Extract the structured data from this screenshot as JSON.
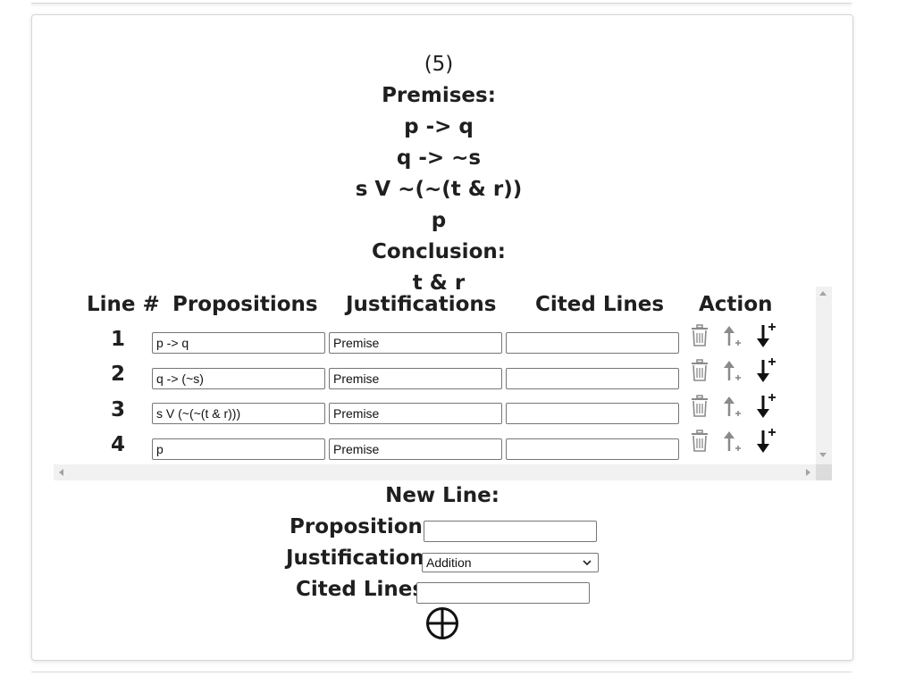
{
  "problem": {
    "number": "(5)",
    "premises_label": "Premises:",
    "premises": [
      "p -> q",
      "q -> ~s",
      "s V ~(~(t & r))",
      "p"
    ],
    "conclusion_label": "Conclusion:",
    "conclusion": "t & r"
  },
  "table": {
    "headers": {
      "line": "Line #",
      "propositions": "Propositions",
      "justifications": "Justifications",
      "cited": "Cited Lines",
      "action": "Action"
    },
    "rows": [
      {
        "num": "1",
        "proposition": "p -> q",
        "justification": "Premise",
        "cited": ""
      },
      {
        "num": "2",
        "proposition": "q -> (~s)",
        "justification": "Premise",
        "cited": ""
      },
      {
        "num": "3",
        "proposition": "s V (~(~(t & r)))",
        "justification": "Premise",
        "cited": ""
      },
      {
        "num": "4",
        "proposition": "p",
        "justification": "Premise",
        "cited": ""
      }
    ],
    "row_icons": [
      "trash-icon",
      "move-up-icon",
      "insert-below-icon"
    ]
  },
  "new_line": {
    "title": "New Line:",
    "proposition_label": "Proposition:",
    "proposition_value": "",
    "justification_label": "Justification:",
    "justification_selected": "Addition",
    "cited_label": "Cited Lines:",
    "cited_value": "",
    "add_icon": "circled-plus-icon"
  },
  "colors": {
    "text": "#1f1f1f",
    "icon_gray": "#8a8a8a",
    "icon_dark": "#111111",
    "scroll_track": "#f1f1f1"
  }
}
